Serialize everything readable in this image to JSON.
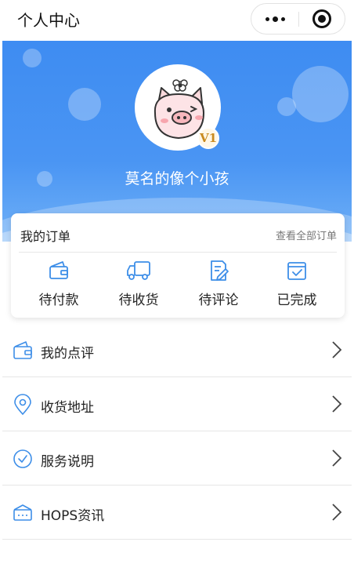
{
  "nav": {
    "title": "个人中心"
  },
  "profile": {
    "username": "莫名的像个小孩",
    "level_badge": "V1"
  },
  "orders": {
    "title": "我的订单",
    "view_all": "查看全部订单",
    "items": [
      {
        "label": "待付款",
        "icon": "wallet-icon"
      },
      {
        "label": "待收货",
        "icon": "truck-icon"
      },
      {
        "label": "待评论",
        "icon": "edit-note-icon"
      },
      {
        "label": "已完成",
        "icon": "check-calendar-icon"
      }
    ]
  },
  "menu": [
    {
      "label": "我的点评",
      "icon": "wallet-icon"
    },
    {
      "label": "收货地址",
      "icon": "location-pin-icon"
    },
    {
      "label": "服务说明",
      "icon": "check-circle-icon"
    },
    {
      "label": "HOPS资讯",
      "icon": "news-box-icon"
    }
  ],
  "colors": {
    "accent": "#3e8cf2",
    "icon_blue": "#3d8ee8",
    "text": "#222222",
    "muted": "#777777"
  }
}
